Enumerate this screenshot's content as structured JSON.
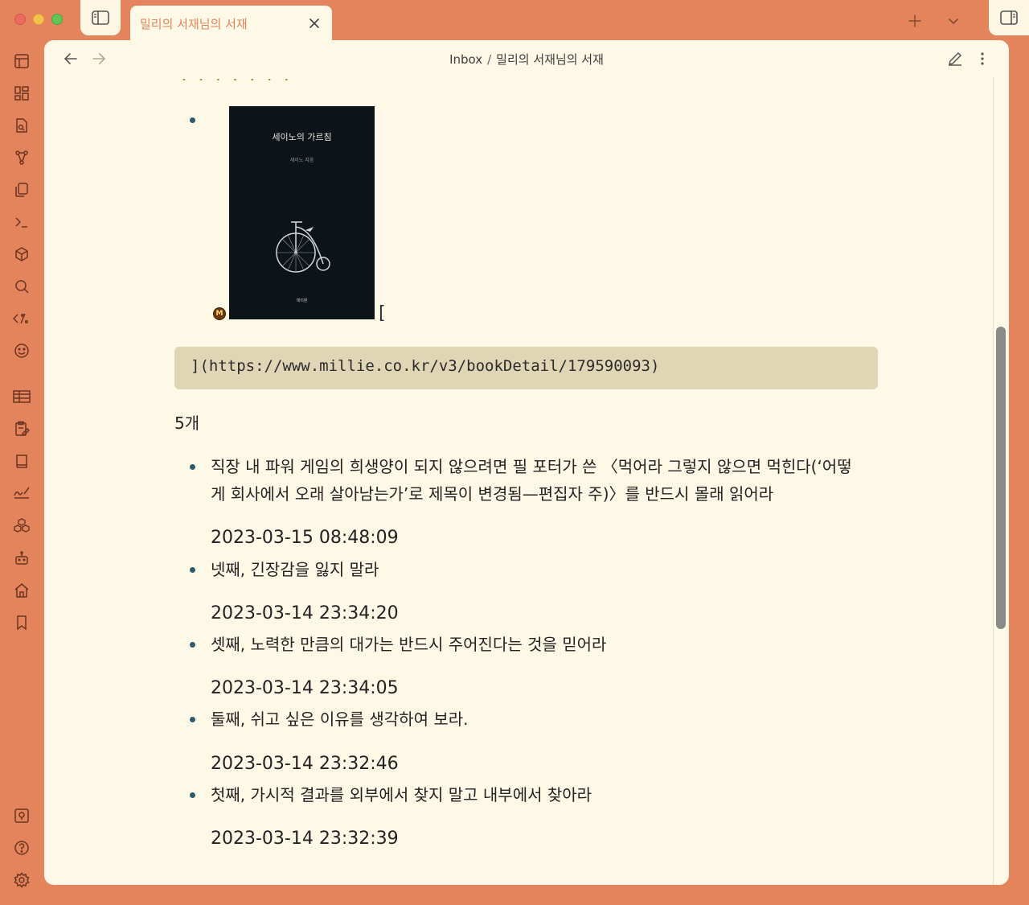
{
  "tab": {
    "title": "밀리의 서재님의 서재"
  },
  "breadcrumb": {
    "folder": "Inbox",
    "separator": "/",
    "file": "밀리의 서재님의 서재"
  },
  "book": {
    "title": "세이노의 가르침",
    "author": "세이노 지음",
    "publisher": "데이원",
    "badge": "M",
    "link_bracket_open": "[",
    "link_tail": "](https://www.millie.co.kr/v3/bookDetail/179590093)"
  },
  "count_label": "5개",
  "highlights": [
    {
      "line1": "직장 내 파워 게임의 희생양이 되지 않으려면 필 포터가 쓴 〈먹어라 그렇지 않으면 먹힌다(‘어떻",
      "line2": "게 회사에서 오래 살아남는가’로 제목이 변경됨—편집자 주)〉를 반드시 몰래 읽어라",
      "date": "2023-03-15 08:48:09"
    },
    {
      "line1": "넷째, 긴장감을 잃지 말라",
      "date": "2023-03-14 23:34:20"
    },
    {
      "line1": "셋째, 노력한 만큼의 대가는 반드시 주어진다는 것을 믿어라",
      "date": "2023-03-14 23:34:05"
    },
    {
      "line1": "둘째, 쉬고 싶은 이유를 생각하여 보라.",
      "date": "2023-03-14 23:32:46"
    },
    {
      "line1": "첫째, 가시적 결과를 외부에서 찾지 말고 내부에서 찾아라",
      "date": "2023-03-14 23:32:39"
    }
  ],
  "colors": {
    "accent": "#e3845c",
    "background": "#fef8e6",
    "code_bg": "#e0d6b6",
    "bullet": "#2d5a6e"
  },
  "icons": {
    "ribbon": [
      "layout-icon",
      "dashboard-icon",
      "file-search-icon",
      "graph-icon",
      "copy-icon",
      "terminal-icon",
      "cube-icon",
      "search-icon",
      "template-icon",
      "smile-icon",
      "table-icon",
      "clipboard-edit-icon",
      "book-icon",
      "signature-icon",
      "boxes-icon",
      "robot-icon",
      "home-icon",
      "bookmark-icon"
    ],
    "bottom": [
      "vault-icon",
      "help-icon",
      "settings-icon"
    ]
  }
}
